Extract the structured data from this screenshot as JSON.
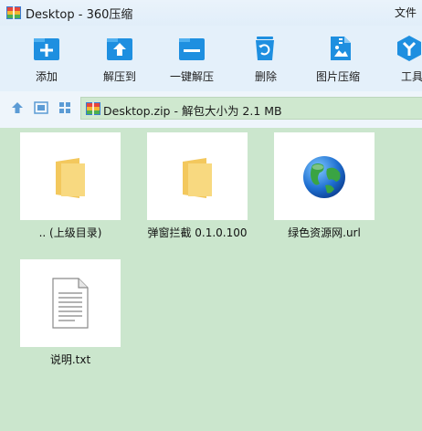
{
  "window": {
    "title": "Desktop - 360压缩",
    "menu_file": "文件"
  },
  "toolbar": {
    "add": "添加",
    "extract_to": "解压到",
    "one_click_extract": "一键解压",
    "delete": "删除",
    "image_compress": "图片压缩",
    "tools": "工具"
  },
  "address": {
    "path": "Desktop.zip - 解包大小为 2.1 MB"
  },
  "files": [
    {
      "name": ".. (上级目录)",
      "icon": "folder-icon"
    },
    {
      "name": "弹窗拦截 0.1.0.100",
      "icon": "folder-icon"
    },
    {
      "name": "绿色资源网.url",
      "icon": "globe-icon"
    },
    {
      "name": "说明.txt",
      "icon": "text-file-icon"
    }
  ],
  "colors": {
    "toolbar_bg": "#e4f0fa",
    "icon_blue": "#1e8fe0",
    "content_bg": "#cbe6cd",
    "folder": "#f6cf6a"
  }
}
